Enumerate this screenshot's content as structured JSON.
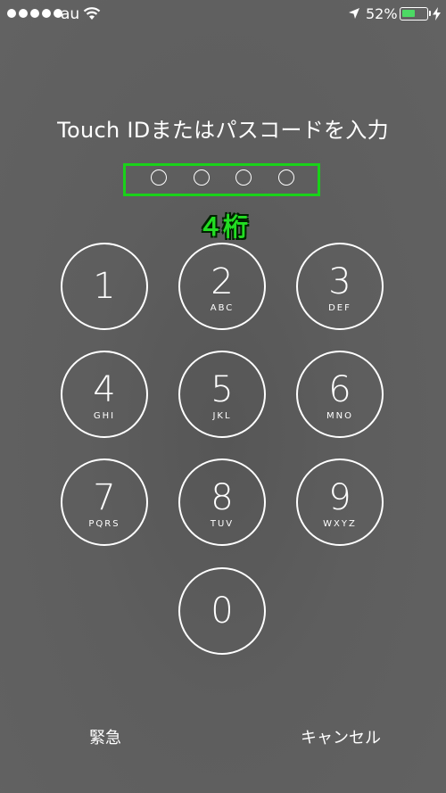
{
  "status_bar": {
    "carrier": "au",
    "battery_percent": "52%",
    "battery_level": 0.52,
    "battery_color": "#4cd964"
  },
  "lock_screen": {
    "prompt": "Touch IDまたはパスコードを入力",
    "digits_annotation": "４桁",
    "highlight_color": "#19d219",
    "passcode_length": 4
  },
  "keypad": {
    "keys": [
      {
        "number": "1",
        "letters": ""
      },
      {
        "number": "2",
        "letters": "ABC"
      },
      {
        "number": "3",
        "letters": "DEF"
      },
      {
        "number": "4",
        "letters": "GHI"
      },
      {
        "number": "5",
        "letters": "JKL"
      },
      {
        "number": "6",
        "letters": "MNO"
      },
      {
        "number": "7",
        "letters": "PQRS"
      },
      {
        "number": "8",
        "letters": "TUV"
      },
      {
        "number": "9",
        "letters": "WXYZ"
      },
      {
        "number": "0",
        "letters": ""
      }
    ]
  },
  "bottom": {
    "emergency_label": "緊急",
    "cancel_label": "キャンセル"
  },
  "icons": {
    "wifi": "wifi-icon",
    "location": "location-arrow-icon",
    "battery": "battery-icon",
    "charging": "charging-bolt-icon"
  }
}
